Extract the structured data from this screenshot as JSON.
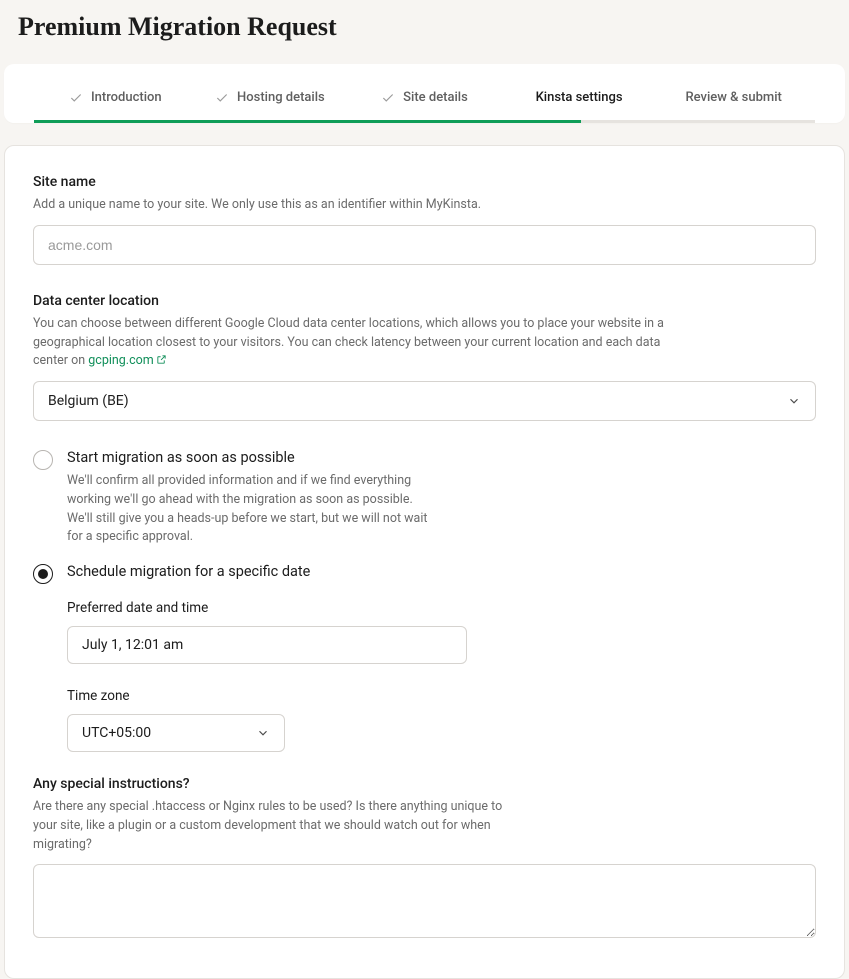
{
  "page_title": "Premium Migration Request",
  "stepper": {
    "steps": [
      {
        "label": "Introduction",
        "done": true
      },
      {
        "label": "Hosting details",
        "done": true
      },
      {
        "label": "Site details",
        "done": true
      },
      {
        "label": "Kinsta settings",
        "active": true
      },
      {
        "label": "Review & submit"
      }
    ]
  },
  "site_name": {
    "label": "Site name",
    "help": "Add a unique name to your site. We only use this as an identifier within MyKinsta.",
    "placeholder": "acme.com",
    "value": ""
  },
  "data_center": {
    "label": "Data center location",
    "help_pre": "You can choose between different Google Cloud data center locations, which allows you to place your website in a geographical location closest to your visitors. You can check latency between your current location and each data center on ",
    "link_text": "gcping.com",
    "selected": "Belgium (BE)"
  },
  "migration": {
    "asap": {
      "label": "Start migration as soon as possible",
      "help": "We'll confirm all provided information and if we find everything working we'll go ahead with the migration as soon as possible. We'll still give you a heads-up before we start, but we will not wait for a specific approval."
    },
    "schedule": {
      "label": "Schedule migration for a specific date",
      "date_label": "Preferred date and time",
      "date_value": "July 1, 12:01 am",
      "tz_label": "Time zone",
      "tz_value": "UTC+05:00"
    }
  },
  "special": {
    "label": "Any special instructions?",
    "help": "Are there any special .htaccess or Nginx rules to be used? Is there anything unique to your site, like a plugin or a custom development that we should watch out for when migrating?",
    "value": ""
  }
}
